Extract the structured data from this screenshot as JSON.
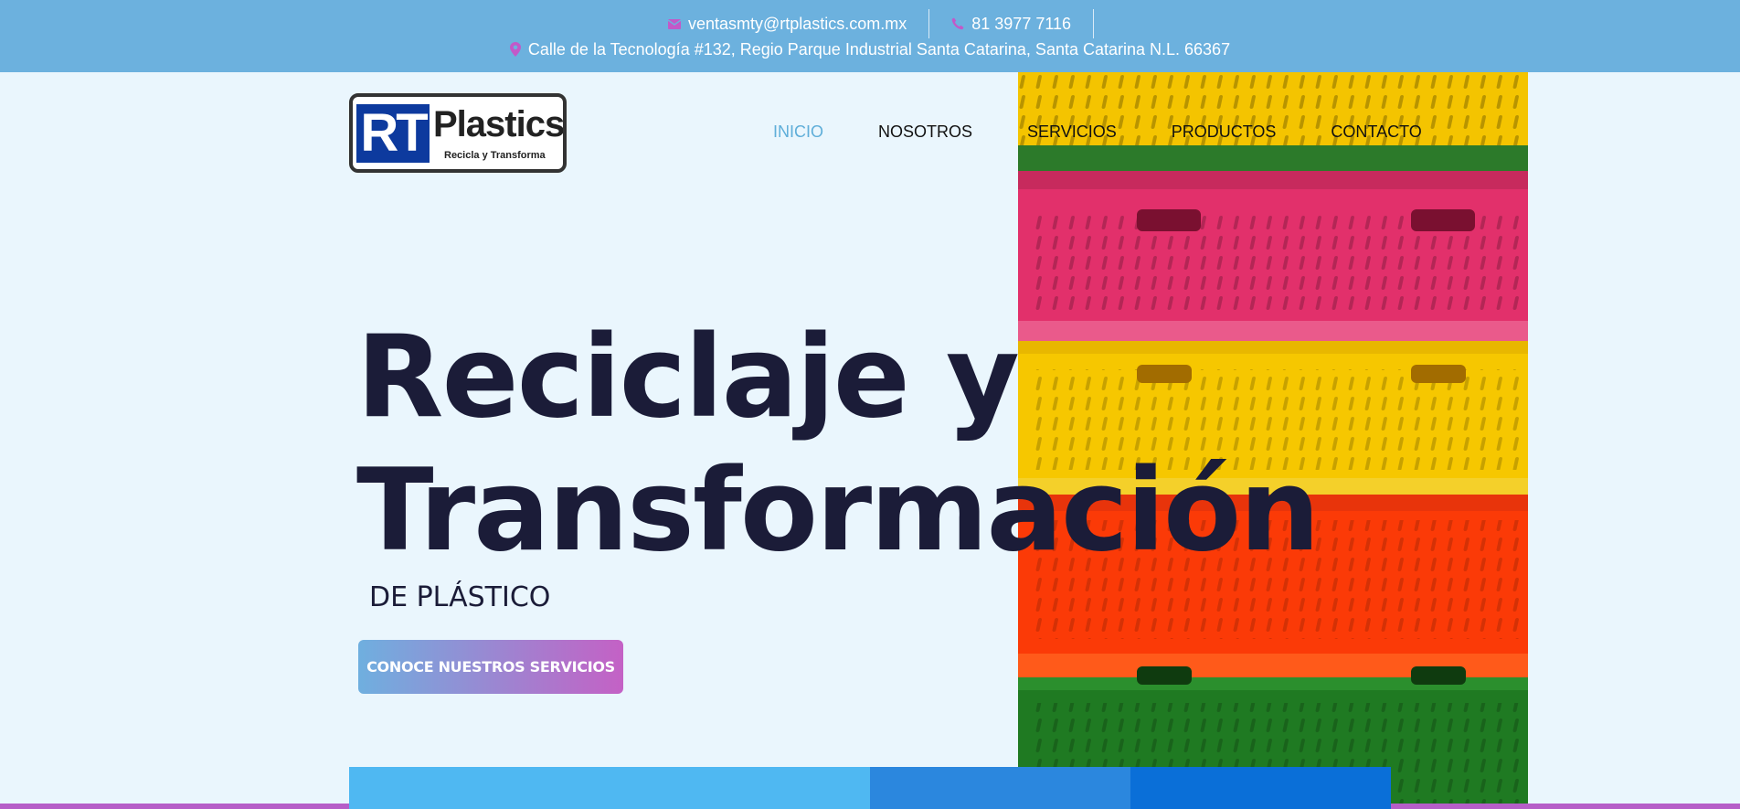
{
  "topbar": {
    "email": "ventasmty@rtplastics.com.mx",
    "phone": "81 3977 7116",
    "address": "Calle de la Tecnología #132, Regio Parque Industrial Santa Catarina, Santa Catarina N.L. 66367",
    "icon_color": "#c259c8",
    "icons": [
      "envelope-icon",
      "phone-icon",
      "map-pin-icon"
    ]
  },
  "logo": {
    "mark": "RT",
    "name": "Plastics",
    "tagline": "Recicla y Transforma"
  },
  "nav": {
    "items": [
      {
        "label": "INICIO",
        "active": true
      },
      {
        "label": "NOSOTROS"
      },
      {
        "label": "SERVICIOS"
      },
      {
        "label": "PRODUCTOS"
      },
      {
        "label": "CONTACTO"
      }
    ]
  },
  "hero": {
    "title_line1": "Reciclaje y",
    "title_line2": "Transformación",
    "subtitle": "DE PLÁSTICO",
    "cta_label": "CONOCE NUESTROS SERVICIOS"
  },
  "colors": {
    "topbar": "#6cb1de",
    "background": "#eaf6fd",
    "heading": "#1b1c38",
    "accent": "#5faed9",
    "gradient_start": "#6fafdf",
    "gradient_end": "#c461c5"
  }
}
